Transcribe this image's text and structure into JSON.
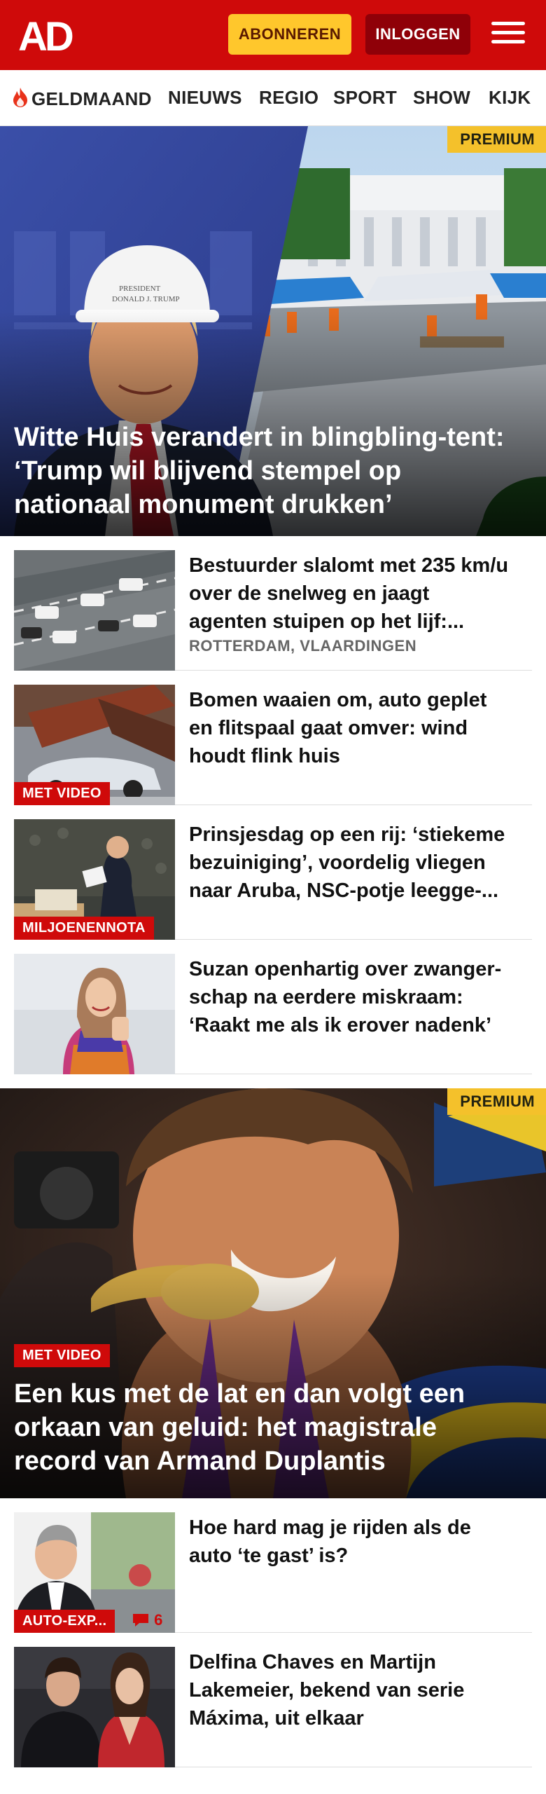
{
  "header": {
    "logo_text": "AD",
    "subscribe_label": "ABONNEREN",
    "login_label": "INLOGGEN",
    "brand_color": "#cf0a0a",
    "accent_color": "#ffc72c"
  },
  "nav": {
    "items": [
      "GELDMAAND",
      "NIEUWS",
      "REGIO",
      "SPORT",
      "SHOW",
      "KIJK"
    ]
  },
  "hero1": {
    "premium_label": "PREMIUM",
    "title": "Witte Huis verandert in blingbling-tent: ‘Trump wil blijvend stempel op nationaal monument drukken’"
  },
  "articles1": [
    {
      "title": "Bestuurder slalomt met 235 km/u over de snelweg en jaagt agenten stuipen op het lijf:...",
      "meta": "ROTTERDAM, VLAARDINGEN"
    },
    {
      "title": "Bomen waaien om, auto geplet en flitspaal gaat omver: wind houdt flink huis",
      "badge": "MET VIDEO"
    },
    {
      "title": "Prinsjesdag op een rij: ‘stiekeme bezuiniging’, voordelig vliegen naar Aruba, NSC-potje leegge-...",
      "badge": "MILJOENENNOTA"
    },
    {
      "title": "Suzan openhartig over zwanger-schap na eerdere miskraam: ‘Raakt me als ik erover nadenk’"
    }
  ],
  "hero2": {
    "premium_label": "PREMIUM",
    "badge": "MET VIDEO",
    "title": "Een kus met de lat en dan volgt een orkaan van geluid: het magistrale record van Armand Duplantis"
  },
  "articles2": [
    {
      "title": "Hoe hard mag je rijden als de auto ‘te gast’ is?",
      "badge": "AUTO-EXP...",
      "comments": "6"
    },
    {
      "title": "Delfina Chaves en Martijn Lakemeier, bekend van serie Máxima, uit elkaar"
    }
  ]
}
